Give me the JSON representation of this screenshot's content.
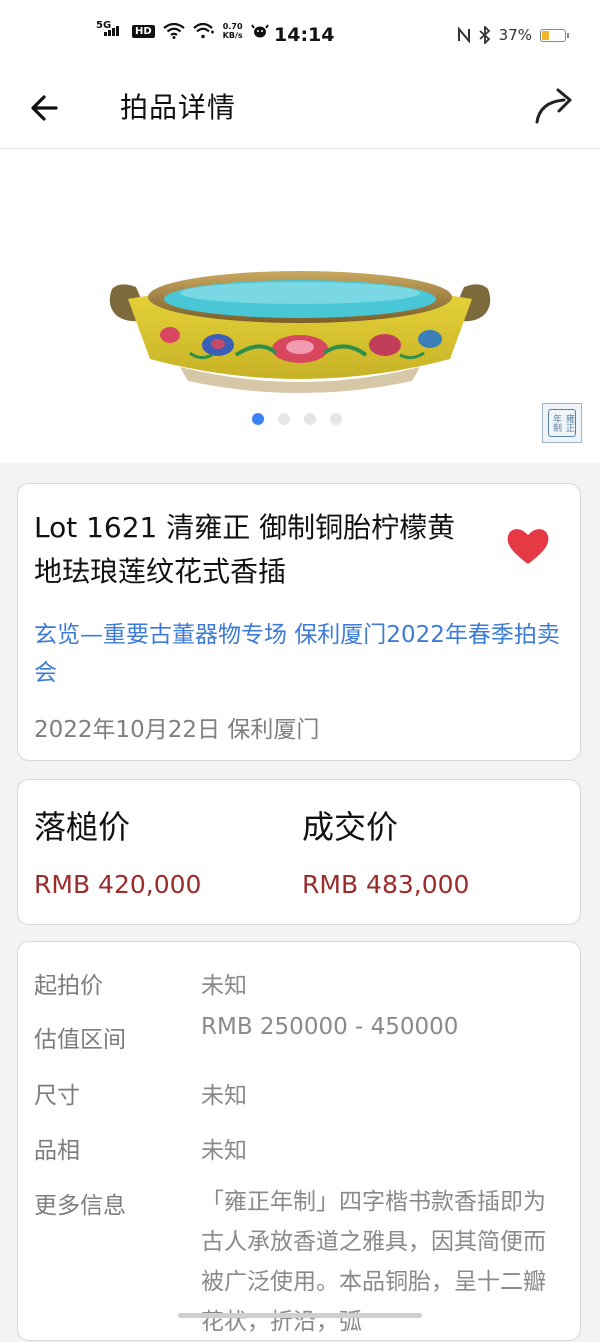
{
  "status_bar": {
    "network": "5G",
    "hd": "HD",
    "speed_value": "0.70",
    "speed_unit": "KB/s",
    "time": "14:14",
    "battery": "37%",
    "battery_level": 0.37,
    "battery_color": "#f2b52a"
  },
  "header": {
    "title": "拍品详情",
    "back_icon": "arrow-left-icon",
    "share_icon": "share-arrow-icon"
  },
  "gallery": {
    "image_count": 4,
    "active_index": 0,
    "seal_text": "雍正年制"
  },
  "lot": {
    "title": "Lot 1621 清雍正 御制铜胎柠檬黄地珐琅莲纹花式香插",
    "auction": "玄览—重要古董器物专场 保利厦门2022年春季拍卖会",
    "date_house": "2022年10月22日 保利厦门",
    "favorited": true,
    "heart_color": "#e53945"
  },
  "prices": {
    "hammer_label": "落槌价",
    "hammer_value": "RMB 420,000",
    "deal_label": "成交价",
    "deal_value": "RMB 483,000",
    "value_color": "#9b2c2c"
  },
  "details": {
    "start_label": "起拍价",
    "start_value": "未知",
    "estimate_label": "估值区间",
    "estimate_value": "RMB 250000 - 450000",
    "size_label": "尺寸",
    "size_value": "未知",
    "condition_label": "品相",
    "condition_value": "未知",
    "more_label": "更多信息",
    "more_value": "「雍正年制」四字楷书款香插即为古人承放香道之雅具，因其简便而被广泛使用。本品铜胎，呈十二瓣花状，折沿，弧"
  }
}
